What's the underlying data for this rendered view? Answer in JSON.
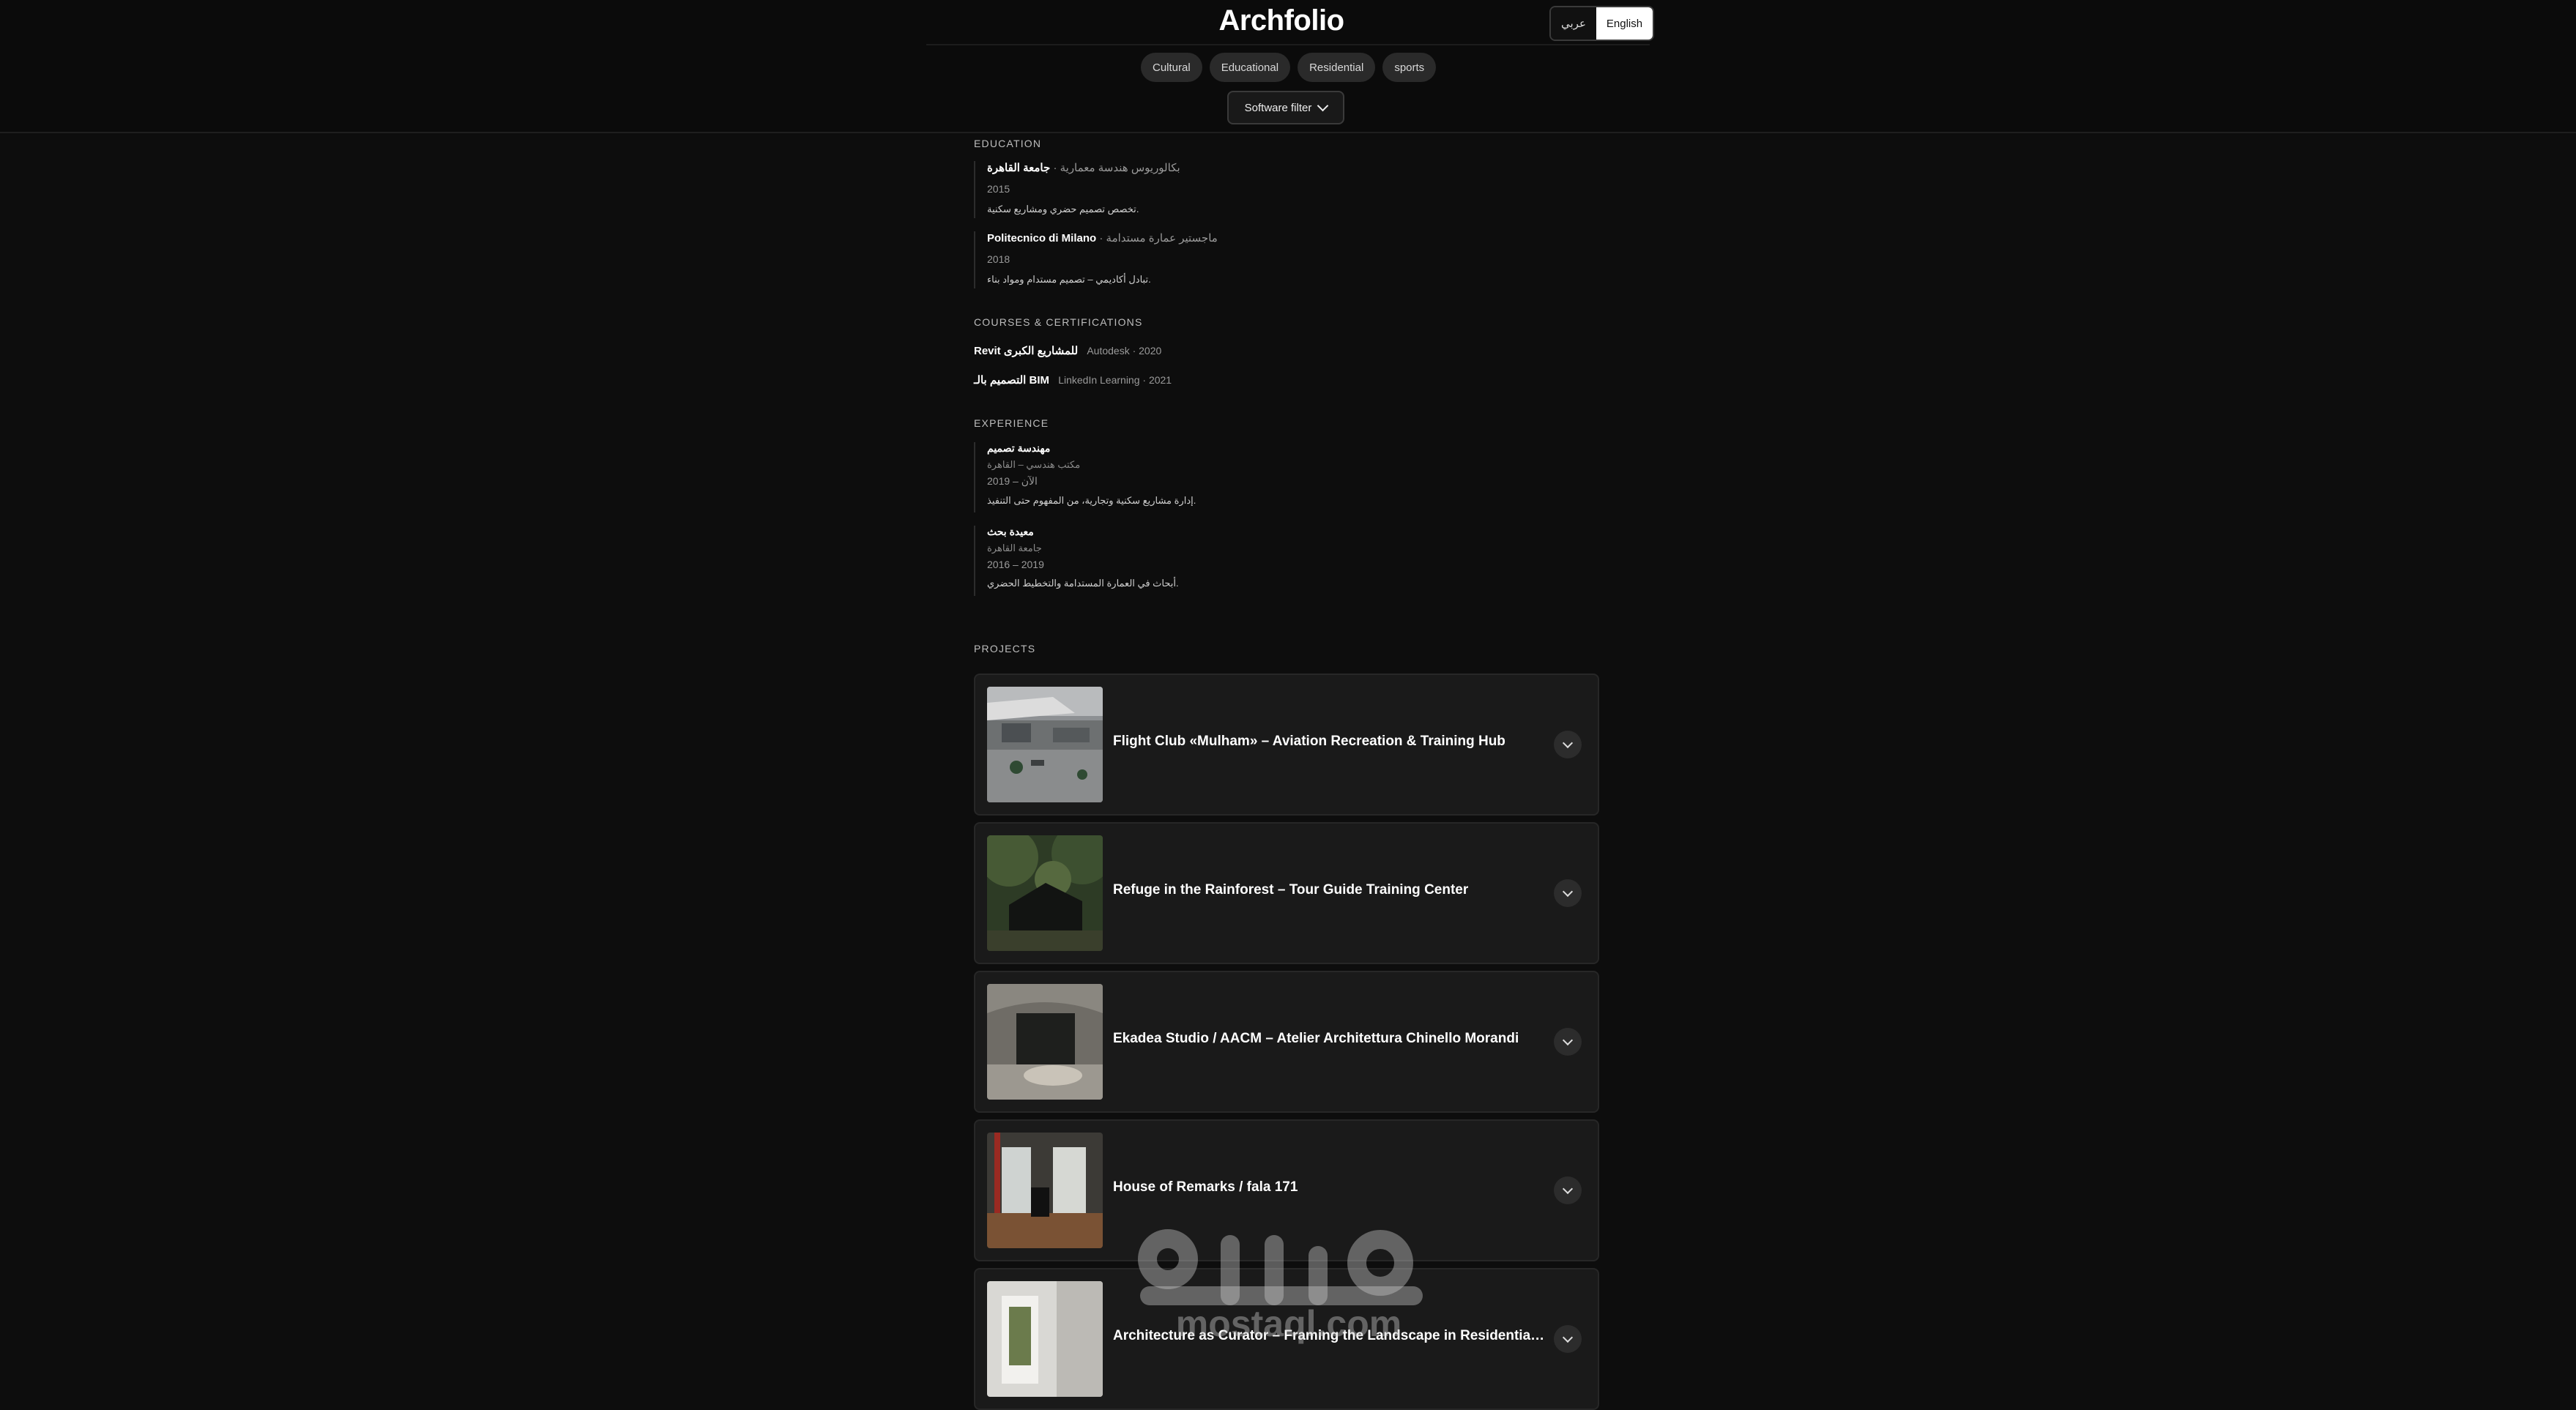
{
  "header": {
    "brand": "Archfolio",
    "languages": [
      {
        "label": "عربي",
        "active": false
      },
      {
        "label": "English",
        "active": true
      }
    ],
    "categories": [
      "Cultural",
      "Educational",
      "Residential",
      "sports"
    ],
    "software_filter_label": "Software filter"
  },
  "education": {
    "title": "EDUCATION",
    "items": [
      {
        "school": "جامعة القاهرة",
        "degree": "بكالوريوس هندسة معمارية ·",
        "year": "2015",
        "description": "تخصص تصميم حضري ومشاريع سكنية."
      },
      {
        "school": "Politecnico di Milano",
        "degree": "· ماجستير عمارة مستدامة",
        "year": "2018",
        "description": "تبادل أكاديمي – تصميم مستدام ومواد بناء."
      }
    ]
  },
  "courses": {
    "title": "COURSES & CERTIFICATIONS",
    "items": [
      {
        "name": "Revit للمشاريع الكبرى",
        "meta": "Autodesk · 2020"
      },
      {
        "name": "التصميم بالـ BIM",
        "meta": "LinkedIn Learning · 2021"
      }
    ]
  },
  "experience": {
    "title": "EXPERIENCE",
    "items": [
      {
        "role": "مهندسة تصميم",
        "org": "مكتب هندسي – القاهرة",
        "period": "2019 – الآن",
        "description": "إدارة مشاريع سكنية وتجارية، من المفهوم حتى التنفيذ."
      },
      {
        "role": "معيدة بحث",
        "org": "جامعة القاهرة",
        "period": "2016 – 2019",
        "description": "أبحاث في العمارة المستدامة والتخطيط الحضري."
      }
    ]
  },
  "projects": {
    "title": "PROJECTS",
    "items": [
      {
        "title": "Flight Club «Mulham» – Aviation Recreation & Training Hub",
        "thumb": "aerial-site-photo"
      },
      {
        "title": "Refuge in the Rainforest – Tour Guide Training Center",
        "thumb": "forest-pavilion-photo"
      },
      {
        "title": "Ekadea Studio / AACM – Atelier Architettura Chinello Morandi",
        "thumb": "studio-interior-photo"
      },
      {
        "title": "House of Remarks / fala 171",
        "thumb": "room-windows-photo"
      },
      {
        "title": "Architecture as Curator – Framing the Landscape in Residential Proj…",
        "thumb": "white-interior-photo"
      }
    ]
  },
  "watermark": {
    "text": "mostaql.com"
  },
  "colors": {
    "background": "#0d0d0d",
    "card": "#1a1a1a",
    "pill": "#2a2a2a",
    "text": "#ffffff"
  }
}
